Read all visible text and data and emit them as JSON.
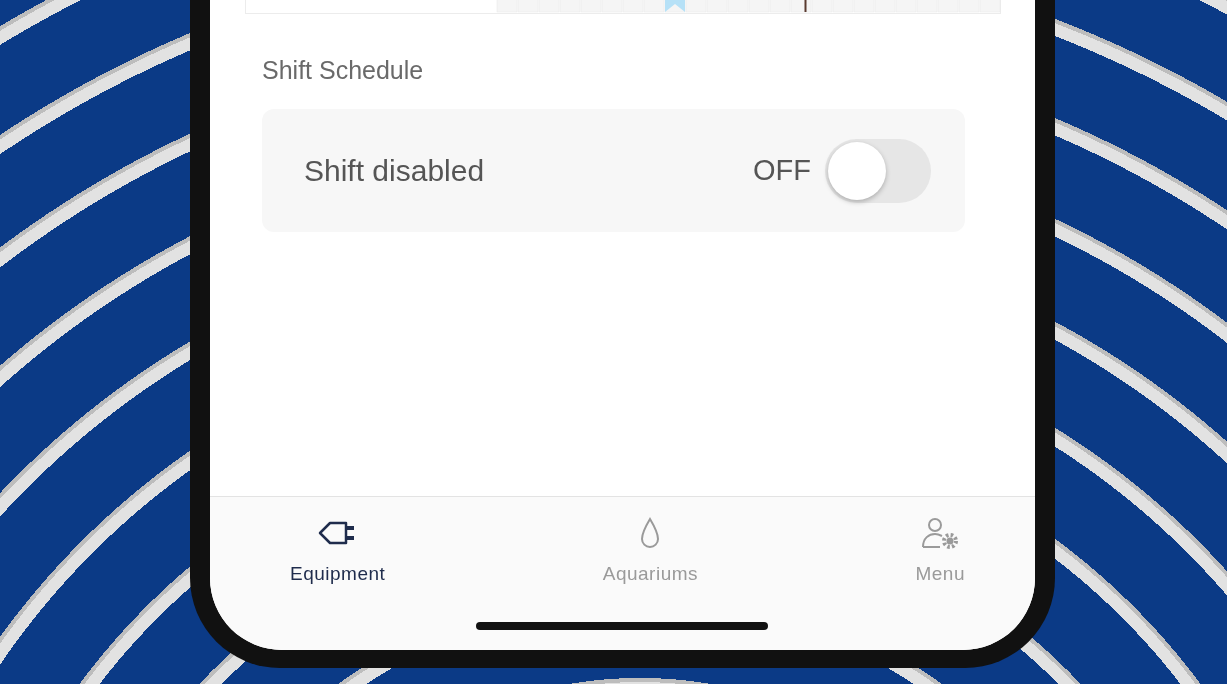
{
  "shift_schedule": {
    "title": "Shift Schedule",
    "toggle": {
      "label": "Shift disabled",
      "state_text": "OFF",
      "on": false
    }
  },
  "tab_bar": [
    {
      "label": "Equipment",
      "kind": "plug",
      "selected": true
    },
    {
      "label": "Aquariums",
      "kind": "drop",
      "selected": false
    },
    {
      "label": "Menu",
      "kind": "user-gear",
      "selected": false
    }
  ]
}
